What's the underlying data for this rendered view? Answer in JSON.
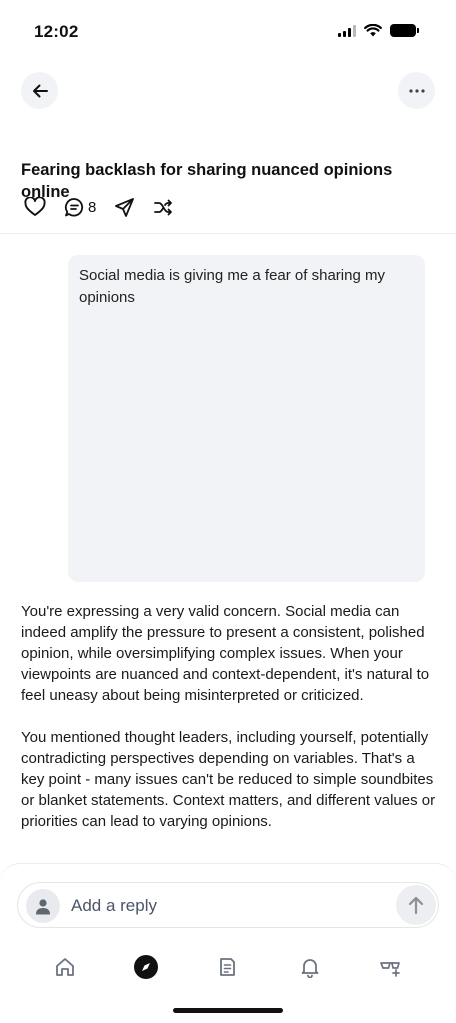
{
  "status_bar": {
    "time": "12:02"
  },
  "header": {
    "back_icon": "arrow-left-icon",
    "more_icon": "ellipsis-icon"
  },
  "thread": {
    "title": "Fearing backlash for sharing nuanced opinions online",
    "actions": {
      "like_icon": "heart-icon",
      "comment_icon": "comment-icon",
      "comment_count": "8",
      "share_icon": "send-icon",
      "remix_icon": "shuffle-icon"
    }
  },
  "messages": {
    "user_prompt": "Social media is giving me a fear of sharing my opinions",
    "response_paragraphs": [
      "You're expressing a very valid concern. Social media can indeed amplify the pressure to present a consistent, polished opinion, while oversimplifying complex issues. When your viewpoints are nuanced and context-dependent, it's natural to feel uneasy about being misinterpreted or criticized.",
      "You mentioned thought leaders, including yourself, potentially contradicting perspectives depending on variables. That's a key point - many issues can't be reduced to simple soundbites or blanket statements. Context matters, and different values or priorities can lead to varying opinions."
    ]
  },
  "reply": {
    "placeholder": "Add a reply",
    "send_icon": "arrow-up-icon"
  },
  "bottom_nav": [
    {
      "icon": "home-icon"
    },
    {
      "icon": "compass-icon",
      "active": true
    },
    {
      "icon": "library-icon"
    },
    {
      "icon": "bell-icon"
    },
    {
      "icon": "glasses-plus-icon"
    }
  ],
  "colors": {
    "bubble_bg": "#f1f3f6",
    "text": "#111111",
    "muted": "#4a5568",
    "icon": "#222222"
  }
}
